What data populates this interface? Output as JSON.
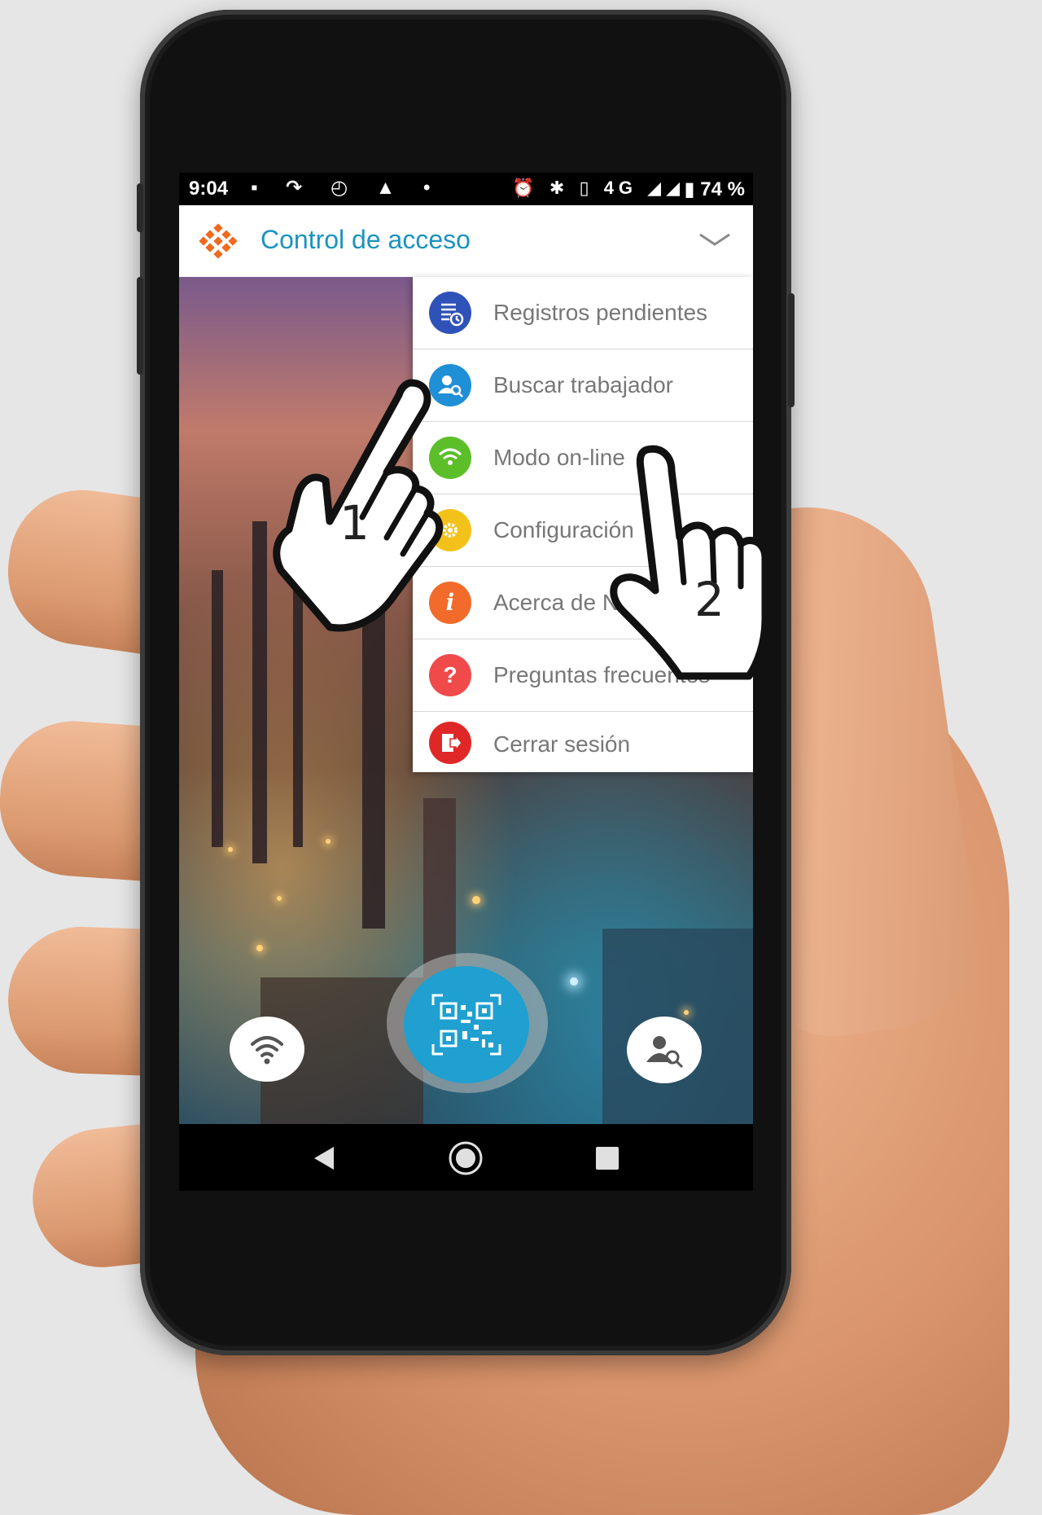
{
  "status_bar": {
    "time": "9:04",
    "network": "4G",
    "battery": "74 %"
  },
  "app": {
    "title": "Control de acceso"
  },
  "menu": {
    "items": [
      {
        "label": "Registros pendientes",
        "icon": "pending-records-icon",
        "color": "#2f52b8"
      },
      {
        "label": "Buscar trabajador",
        "icon": "search-worker-icon",
        "color": "#1f8fd6"
      },
      {
        "label": "Modo on-line",
        "icon": "wifi-icon",
        "color": "#5cbf2a"
      },
      {
        "label": "Configuración",
        "icon": "gear-icon",
        "color": "#f3c21a"
      },
      {
        "label": "Acerca de N",
        "icon": "info-icon",
        "color": "#f26b2b"
      },
      {
        "label": "Preguntas frecuentes",
        "icon": "question-icon",
        "color": "#f04a4a"
      },
      {
        "label": "Cerrar sesión",
        "icon": "logout-icon",
        "color": "#e02727"
      }
    ],
    "glyphs": [
      "",
      "",
      "",
      "",
      "i",
      "?",
      ""
    ]
  },
  "pointers": [
    {
      "number": "1"
    },
    {
      "number": "2"
    }
  ],
  "colors": {
    "title": "#1b93c0",
    "qr_button": "#1fa0d0",
    "logo": "#f06a1e"
  }
}
